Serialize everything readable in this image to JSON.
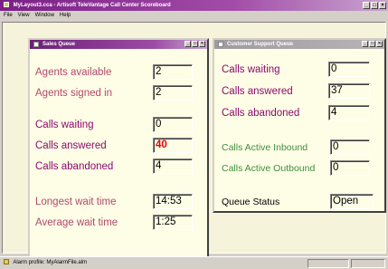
{
  "app": {
    "title": "MyLayout3.cca - Artisoft TeleVantage Call Center Scoreboard",
    "menu": [
      "File",
      "View",
      "Window",
      "Help"
    ]
  },
  "sales": {
    "title": "Sales Queue",
    "agents_available": {
      "label": "Agents available",
      "value": "2"
    },
    "agents_signed_in": {
      "label": "Agents signed in",
      "value": "2"
    },
    "calls_waiting": {
      "label": "Calls waiting",
      "value": "0"
    },
    "calls_answered": {
      "label": "Calls answered",
      "value": "40"
    },
    "calls_abandoned": {
      "label": "Calls abandoned",
      "value": "4"
    },
    "longest_wait": {
      "label": "Longest wait time",
      "value": "14:53"
    },
    "average_wait": {
      "label": "Average wait time",
      "value": "1:25"
    }
  },
  "support": {
    "title": "Customer Support Queue",
    "calls_waiting": {
      "label": "Calls waiting",
      "value": "0"
    },
    "calls_answered": {
      "label": "Calls answered",
      "value": "37"
    },
    "calls_abandoned": {
      "label": "Calls abandoned",
      "value": "4"
    },
    "active_inbound": {
      "label": "Calls Active Inbound",
      "value": "0"
    },
    "active_outbound": {
      "label": "Calls Active Outbound",
      "value": "0"
    },
    "queue_status": {
      "label": "Queue Status",
      "value": "Open"
    }
  },
  "statusbar": {
    "text": "Alarm profile: MyAlarmFile.alm"
  },
  "colors": {
    "rose_label": "#b04a6e",
    "magenta_label": "#8b0a6e",
    "green_label": "#3f8f3f",
    "alert_value": "#e00000"
  }
}
